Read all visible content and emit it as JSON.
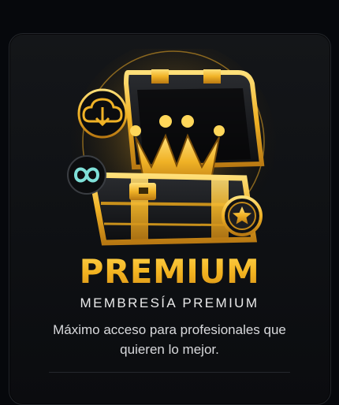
{
  "card": {
    "title": "PREMIUM",
    "subtitle": "MEMBRESÍA PREMIUM",
    "description": "Máximo acceso para profesionales que quieren lo mejor."
  },
  "hero": {
    "icons": [
      "treasure-chest-icon",
      "crown-icon",
      "cloud-download-icon",
      "infinity-icon",
      "star-coin-icon"
    ]
  },
  "colors": {
    "background": "#06080c",
    "card": "#121417",
    "gold": "#f2b21f",
    "text": "#e9e9ea"
  }
}
